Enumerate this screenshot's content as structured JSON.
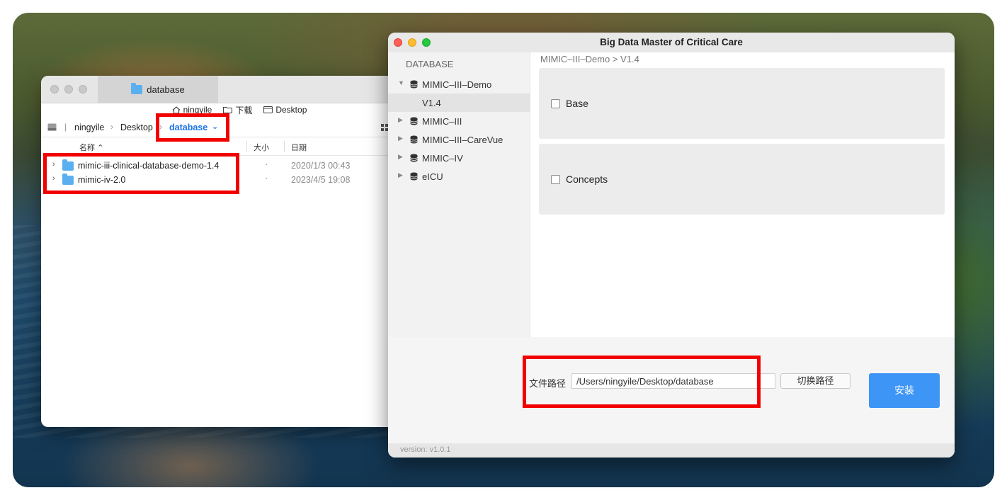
{
  "finder": {
    "tab_title": "database",
    "favorites": [
      "ningyile",
      "下载",
      "Desktop"
    ],
    "path": [
      "ningyile",
      "Desktop",
      "database"
    ],
    "columns": {
      "name": "名称",
      "size": "大小",
      "date": "日期"
    },
    "rows": [
      {
        "name": "mimic-iii-clinical-database-demo-1.4",
        "size": "·",
        "date": "2020/1/3 00:43"
      },
      {
        "name": "mimic-iv-2.0",
        "size": "·",
        "date": "2023/4/5 19:08"
      }
    ]
  },
  "app": {
    "title": "Big Data Master of Critical Care",
    "sidebar_header": "DATABASE",
    "tree": [
      {
        "label": "MIMIC–III–Demo",
        "expanded": true
      },
      {
        "label": "V1.4",
        "child": true,
        "selected": true
      },
      {
        "label": "MIMIC–III"
      },
      {
        "label": "MIMIC–III–CareVue"
      },
      {
        "label": "MIMIC–IV"
      },
      {
        "label": "eICU"
      }
    ],
    "breadcrumb": "MIMIC–III–Demo > V1.4",
    "options": [
      "Base",
      "Concepts"
    ],
    "path_label": "文件路径",
    "path_value": "/Users/ningyile/Desktop/database",
    "switch_button": "切换路径",
    "install_button": "安装",
    "version": "version: v1.0.1"
  }
}
